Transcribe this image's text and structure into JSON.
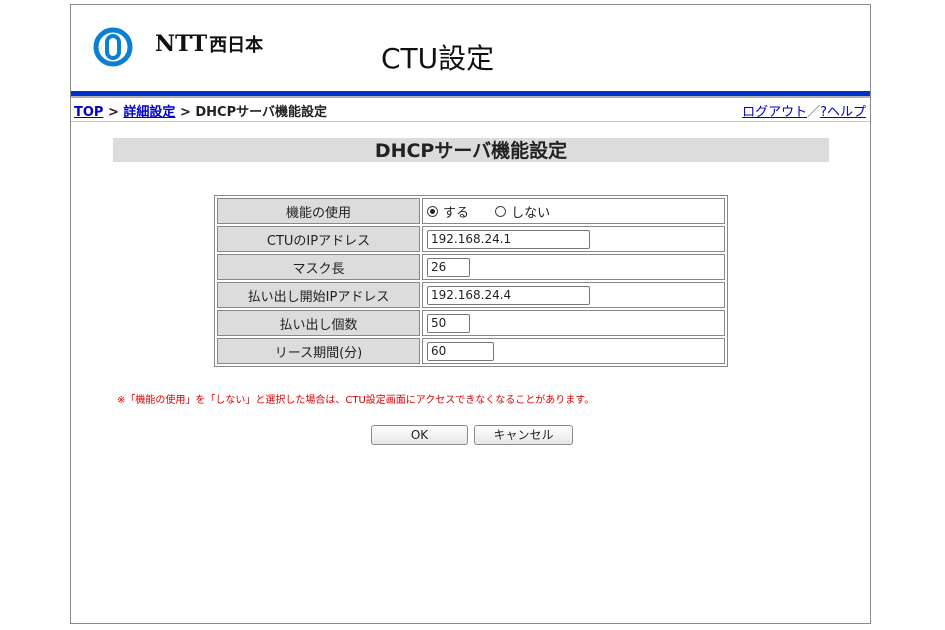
{
  "header": {
    "brand_ntt": "NTT",
    "brand_west": "西日本",
    "app_title": "CTU設定",
    "accent_color": "#0033cc"
  },
  "breadcrumb": {
    "top": "TOP",
    "sep1": " > ",
    "detail": "詳細設定",
    "sep2": " > ",
    "current": "DHCPサーバ機能設定"
  },
  "toplinks": {
    "logout": "ログアウト",
    "sep": "／",
    "help": "?ヘルプ"
  },
  "page": {
    "heading": "DHCPサーバ機能設定"
  },
  "form": {
    "rows": [
      {
        "label": "機能の使用"
      },
      {
        "label": "CTUのIPアドレス"
      },
      {
        "label": "マスク長"
      },
      {
        "label": "払い出し開始IPアドレス"
      },
      {
        "label": "払い出し個数"
      },
      {
        "label": "リース期間(分)"
      }
    ],
    "use_function": {
      "options": [
        "する",
        "しない"
      ],
      "selected": "する"
    },
    "ctu_ip": "192.168.24.1",
    "mask_length": "26",
    "start_ip": "192.168.24.4",
    "count": "50",
    "lease_minutes": "60"
  },
  "note": "※「機能の使用」を「しない」と選択した場合は、CTU設定画面にアクセスできなくなることがあります。",
  "buttons": {
    "ok": "OK",
    "cancel": "キャンセル"
  }
}
